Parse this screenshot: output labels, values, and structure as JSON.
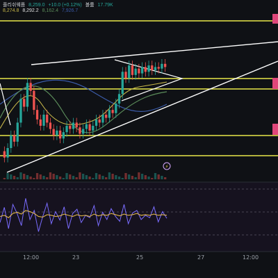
{
  "header": {
    "line1_name": "플리쉬웨픔",
    "line1_values": [
      "8,259.0",
      "+10.0 (+0.12%)",
      "볼륨",
      "17.79K"
    ],
    "line2_values": [
      "8,274.8",
      "8,292.2",
      "8,162.4",
      "7,926.7"
    ]
  },
  "colors": {
    "background": "#0f1115",
    "candle_up": "#26a69a",
    "candle_down": "#ef5350",
    "zone_line": "#e8e84a",
    "trendline": "#ffffff",
    "ma_fast": "#c8b84a",
    "ma_mid": "#5b8c5a",
    "ma_slow": "#3b5ba8",
    "osc_fast": "#7a6cff",
    "osc_slow": "#f0c24a",
    "osc_panel": "#16121f",
    "price_tag": "#e0467a"
  },
  "chart_data": [
    {
      "type": "candlestick",
      "title": "",
      "x_tick_labels": [
        "12:00",
        "23",
        "25",
        "27",
        "12:00"
      ],
      "horizontal_zones": [
        "upper-resistance",
        "middle-zone",
        "lower-support"
      ],
      "trendlines": [
        "upper-rising",
        "lower-rising",
        "triangle"
      ],
      "candles": [
        [
          12,
          8
        ],
        [
          8,
          14
        ],
        [
          14,
          22
        ],
        [
          22,
          18
        ],
        [
          18,
          30
        ],
        [
          30,
          45
        ],
        [
          45,
          40
        ],
        [
          40,
          55
        ],
        [
          55,
          50
        ],
        [
          50,
          38
        ],
        [
          38,
          32
        ],
        [
          32,
          28
        ],
        [
          28,
          35
        ],
        [
          35,
          30
        ],
        [
          30,
          26
        ],
        [
          26,
          22
        ],
        [
          22,
          25
        ],
        [
          25,
          20
        ],
        [
          20,
          24
        ],
        [
          24,
          28
        ],
        [
          28,
          26
        ],
        [
          26,
          30
        ],
        [
          30,
          27
        ],
        [
          27,
          23
        ],
        [
          23,
          26
        ],
        [
          26,
          29
        ],
        [
          29,
          25
        ],
        [
          25,
          28
        ],
        [
          28,
          32
        ],
        [
          32,
          30
        ],
        [
          30,
          35
        ],
        [
          35,
          33
        ],
        [
          33,
          38
        ],
        [
          38,
          36
        ],
        [
          36,
          42
        ],
        [
          42,
          48
        ],
        [
          48,
          62
        ],
        [
          62,
          58
        ],
        [
          58,
          66
        ],
        [
          66,
          60
        ],
        [
          60,
          64
        ],
        [
          64,
          61
        ],
        [
          61,
          65
        ],
        [
          65,
          62
        ],
        [
          62,
          66
        ],
        [
          66,
          63
        ],
        [
          63,
          65
        ],
        [
          65,
          64
        ],
        [
          64,
          67
        ],
        [
          67,
          65
        ]
      ],
      "oscillator_fast": [
        40,
        65,
        30,
        70,
        55,
        35,
        80,
        45,
        60,
        25,
        50,
        72,
        38,
        58,
        44,
        66,
        30,
        55,
        62,
        40,
        52,
        48,
        68,
        35,
        57,
        45,
        63,
        50,
        42,
        70,
        38,
        56,
        60,
        45,
        52,
        48,
        66,
        41,
        58,
        47
      ],
      "oscillator_slow": [
        50,
        52,
        48,
        55,
        57,
        54,
        60,
        58,
        55,
        50,
        49,
        53,
        52,
        50,
        51,
        54,
        52,
        50,
        53,
        51,
        52,
        50,
        54,
        51,
        53,
        52,
        55,
        53,
        51,
        54,
        52,
        53,
        55,
        52,
        53,
        52,
        54,
        52,
        53,
        52
      ]
    }
  ]
}
